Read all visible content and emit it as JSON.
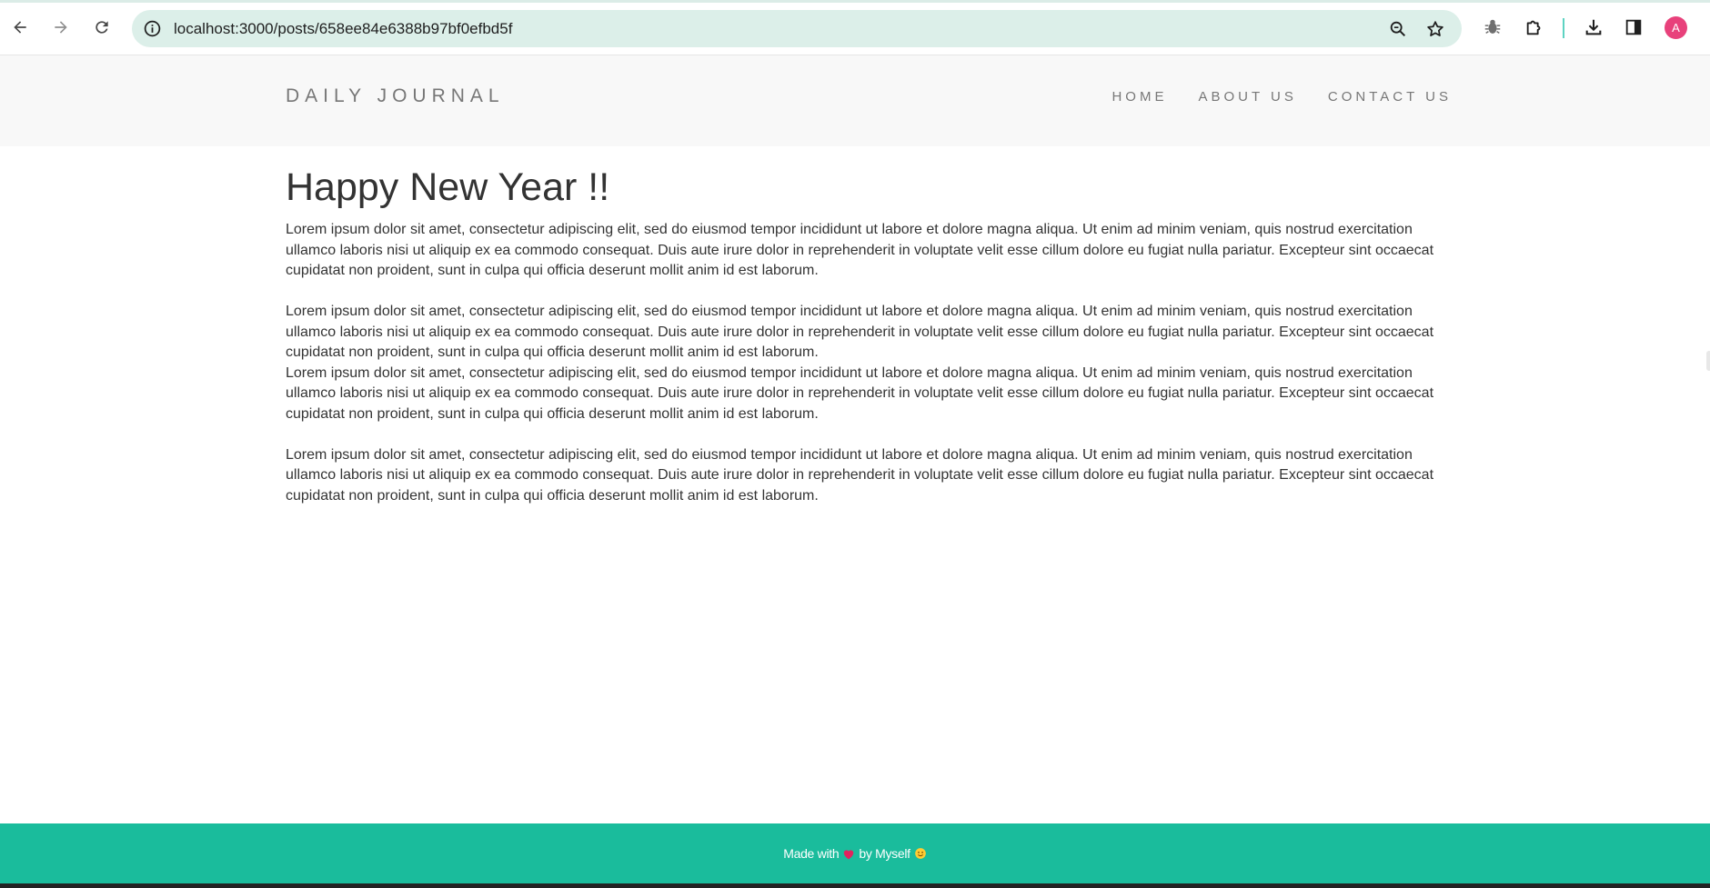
{
  "browser": {
    "url": "localhost:3000/posts/658ee84e6388b97bf0efbd5f",
    "profile_initial": "A"
  },
  "site": {
    "brand": "DAILY JOURNAL",
    "nav": [
      "HOME",
      "ABOUT US",
      "CONTACT US"
    ]
  },
  "post": {
    "title": "Happy New Year !!",
    "body": "Lorem ipsum dolor sit amet, consectetur adipiscing elit, sed do eiusmod tempor incididunt ut labore et dolore magna aliqua. Ut enim ad minim veniam, quis nostrud exercitation ullamco laboris nisi ut aliquip ex ea commodo consequat. Duis aute irure dolor in reprehenderit in voluptate velit esse cillum dolore eu fugiat nulla pariatur. Excepteur sint occaecat cupidatat non proident, sunt in culpa qui officia deserunt mollit anim id est laborum.\n\nLorem ipsum dolor sit amet, consectetur adipiscing elit, sed do eiusmod tempor incididunt ut labore et dolore magna aliqua. Ut enim ad minim veniam, quis nostrud exercitation ullamco laboris nisi ut aliquip ex ea commodo consequat. Duis aute irure dolor in reprehenderit in voluptate velit esse cillum dolore eu fugiat nulla pariatur. Excepteur sint occaecat cupidatat non proident, sunt in culpa qui officia deserunt mollit anim id est laborum.\nLorem ipsum dolor sit amet, consectetur adipiscing elit, sed do eiusmod tempor incididunt ut labore et dolore magna aliqua. Ut enim ad minim veniam, quis nostrud exercitation ullamco laboris nisi ut aliquip ex ea commodo consequat. Duis aute irure dolor in reprehenderit in voluptate velit esse cillum dolore eu fugiat nulla pariatur. Excepteur sint occaecat cupidatat non proident, sunt in culpa qui officia deserunt mollit anim id est laborum.\n\nLorem ipsum dolor sit amet, consectetur adipiscing elit, sed do eiusmod tempor incididunt ut labore et dolore magna aliqua. Ut enim ad minim veniam, quis nostrud exercitation ullamco laboris nisi ut aliquip ex ea commodo consequat. Duis aute irure dolor in reprehenderit in voluptate velit esse cillum dolore eu fugiat nulla pariatur. Excepteur sint occaecat cupidatat non proident, sunt in culpa qui officia deserunt mollit anim id est laborum."
  },
  "footer": {
    "made_with": "Made with",
    "by": "by Myself",
    "heart_icon": "heart-icon",
    "emoji_icon": "smiling-face-icon"
  },
  "colors": {
    "accent": "#1abc9c",
    "omnibox": "#dcefe9",
    "header_bg": "#f8f8f8",
    "avatar": "#e8417b"
  }
}
